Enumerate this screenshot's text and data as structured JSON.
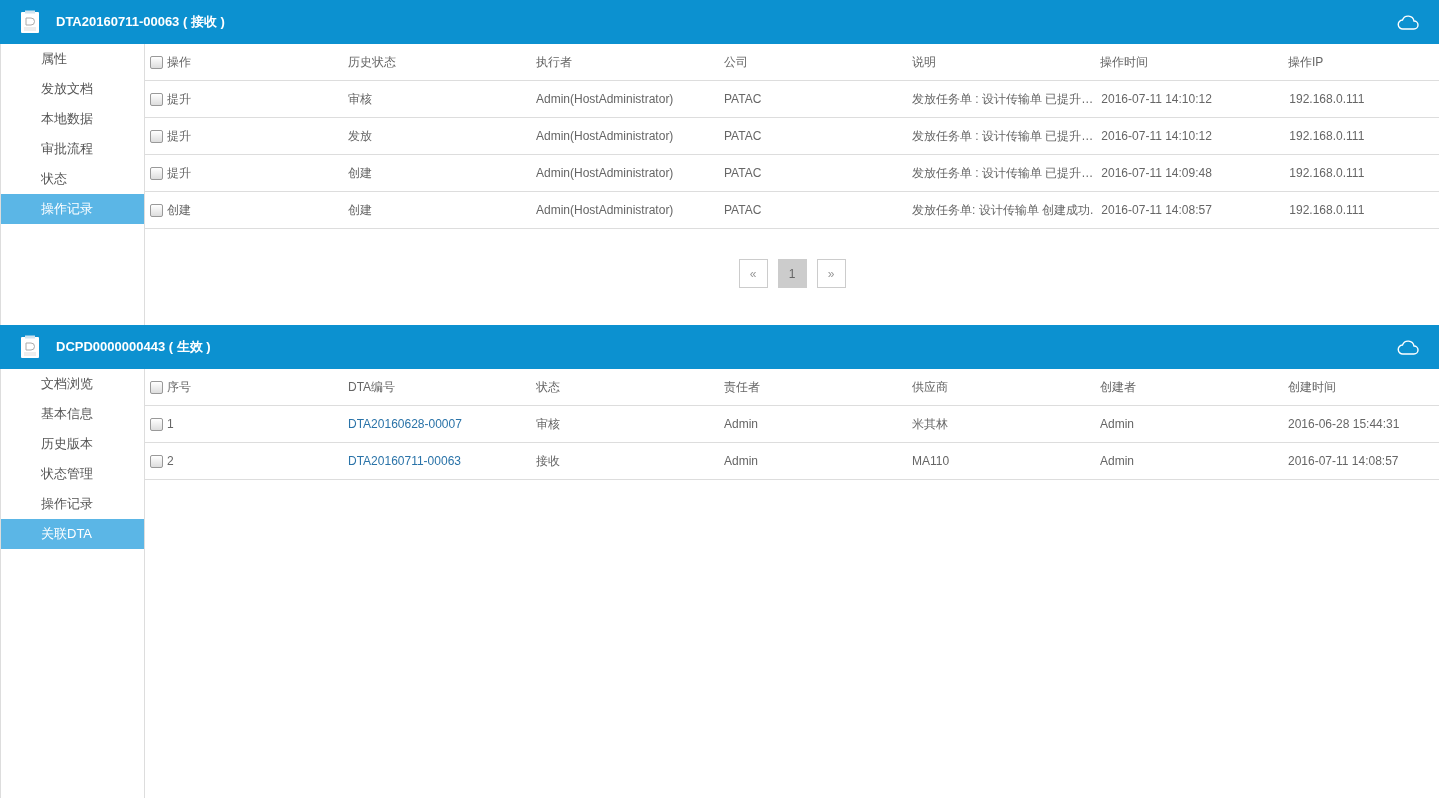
{
  "panels": [
    {
      "title": "DTA20160711-00063 ( 接收 )",
      "sidebar": [
        {
          "label": "属性",
          "selected": false
        },
        {
          "label": "发放文档",
          "selected": false
        },
        {
          "label": "本地数据",
          "selected": false
        },
        {
          "label": "审批流程",
          "selected": false
        },
        {
          "label": "状态",
          "selected": false
        },
        {
          "label": "操作记录",
          "selected": true
        }
      ],
      "table": {
        "header_checked": false,
        "columns": [
          {
            "label": "操作",
            "kind": "text"
          },
          {
            "label": "历史状态",
            "kind": "text"
          },
          {
            "label": "执行者",
            "kind": "text"
          },
          {
            "label": "公司",
            "kind": "text"
          },
          {
            "label": "说明",
            "kind": "text"
          },
          {
            "label": "操作时间",
            "kind": "text"
          },
          {
            "label": "操作IP",
            "kind": "text"
          }
        ],
        "rows": [
          {
            "checked": false,
            "cells": [
              "提升",
              "审核",
              "Admin(HostAdministrator)",
              "PATAC",
              "发放任务单 : 设计传输单 已提升…",
              "2016-07-11 14:10:12",
              "192.168.0.111"
            ]
          },
          {
            "checked": false,
            "cells": [
              "提升",
              "发放",
              "Admin(HostAdministrator)",
              "PATAC",
              "发放任务单 : 设计传输单 已提升…",
              "2016-07-11 14:10:12",
              "192.168.0.111"
            ]
          },
          {
            "checked": false,
            "cells": [
              "提升",
              "创建",
              "Admin(HostAdministrator)",
              "PATAC",
              "发放任务单 : 设计传输单 已提升…",
              "2016-07-11 14:09:48",
              "192.168.0.111"
            ]
          },
          {
            "checked": false,
            "cells": [
              "创建",
              "创建",
              "Admin(HostAdministrator)",
              "PATAC",
              "发放任务单: 设计传输单 创建成功.",
              "2016-07-11 14:08:57",
              "192.168.0.111"
            ]
          }
        ]
      },
      "pagination": [
        {
          "label": "«",
          "selected": false
        },
        {
          "label": "1",
          "selected": true
        },
        {
          "label": "»",
          "selected": false
        }
      ]
    },
    {
      "title": "DCPD0000000443 ( 生效 )",
      "sidebar": [
        {
          "label": "文档浏览",
          "selected": false
        },
        {
          "label": "基本信息",
          "selected": false
        },
        {
          "label": "历史版本",
          "selected": false
        },
        {
          "label": "状态管理",
          "selected": false
        },
        {
          "label": "操作记录",
          "selected": false
        },
        {
          "label": "关联DTA",
          "selected": true
        }
      ],
      "table": {
        "header_checked": false,
        "columns": [
          {
            "label": "序号",
            "kind": "text"
          },
          {
            "label": "DTA编号",
            "kind": "link"
          },
          {
            "label": "状态",
            "kind": "text"
          },
          {
            "label": "责任者",
            "kind": "text"
          },
          {
            "label": "供应商",
            "kind": "text"
          },
          {
            "label": "创建者",
            "kind": "text"
          },
          {
            "label": "创建时间",
            "kind": "text"
          }
        ],
        "rows": [
          {
            "checked": false,
            "cells": [
              "1",
              "DTA20160628-00007",
              "审核",
              "Admin",
              "米其林",
              "Admin",
              "2016-06-28 15:44:31"
            ]
          },
          {
            "checked": false,
            "cells": [
              "2",
              "DTA20160711-00063",
              "接收",
              "Admin",
              "MA110",
              "Admin",
              "2016-07-11 14:08:57"
            ]
          }
        ]
      }
    }
  ]
}
